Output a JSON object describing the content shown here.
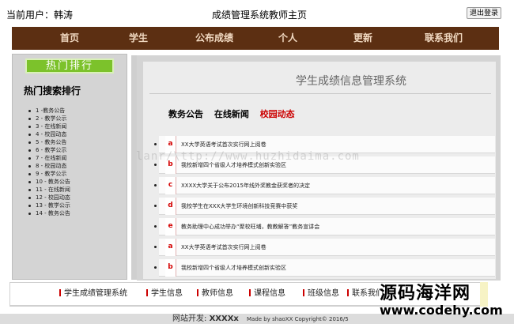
{
  "header": {
    "current_user": "当前用户：韩涛",
    "page_title": "成绩管理系统教师主页",
    "logout_label": "退出登录"
  },
  "nav": {
    "items": [
      "首页",
      "学生",
      "公布成绩",
      "个人",
      "更新",
      "联系我们"
    ]
  },
  "sidebar": {
    "banner": "热门排行",
    "title": "热门搜索排行",
    "items": [
      "1 -教务公告",
      "2 - 教学公示",
      "3 - 在线新闻",
      "4 - 校园动态",
      "5 - 教务公告",
      "6 - 教学公示",
      "7 - 在线新闻",
      "8 - 校园动态",
      "9 - 教学公示",
      "10 - 教务公告",
      "11 - 在线新闻",
      "12 - 校园动态",
      "13 - 教学公示",
      "14 - 教务公告"
    ]
  },
  "main": {
    "system_title": "学生成绩信息管理系统",
    "tabs": [
      {
        "label": "教务公告",
        "active": false
      },
      {
        "label": "在线新闻",
        "active": false
      },
      {
        "label": "校园动态",
        "active": true
      }
    ],
    "news": [
      {
        "letter": "a",
        "text": "XX大学英语考试首次实行网上阅卷"
      },
      {
        "letter": "b",
        "text": "我校新增四个省级人才培养模式创新实验区"
      },
      {
        "letter": "c",
        "text": "XXXX大学关于公布2015年线外奖教金获奖者的决定"
      },
      {
        "letter": "d",
        "text": "我校学生在XXX大学生环境创新科技竞赛中获奖"
      },
      {
        "letter": "e",
        "text": "教务助理中心成功举办“聚校旺埔，教教解答”教务宣讲会"
      },
      {
        "letter": "a",
        "text": "XX大学英语考试首次实行网上阅卷"
      },
      {
        "letter": "b",
        "text": "我校新增四个省级人才培养模式创新实验区"
      }
    ]
  },
  "watermark": "lanr/\\ttp://www.huzhidaima.com",
  "footer": {
    "links": [
      "学生成绩管理系统",
      "学生信息",
      "教师信息",
      "课程信息",
      "班级信息",
      "联系我们"
    ],
    "dev_label": "网站开发:",
    "dev_name": "XXXXx",
    "made_by": "Made by shaoXX  Copyright© 2016/5"
  },
  "overlay": {
    "cn": "源码海洋网",
    "url": "www.codehy.com"
  },
  "colors": {
    "nav_bg": "#5c2f12",
    "nav_text": "#f0d8c0",
    "accent_red": "#cc0000",
    "banner_green": "#7cc22b"
  }
}
